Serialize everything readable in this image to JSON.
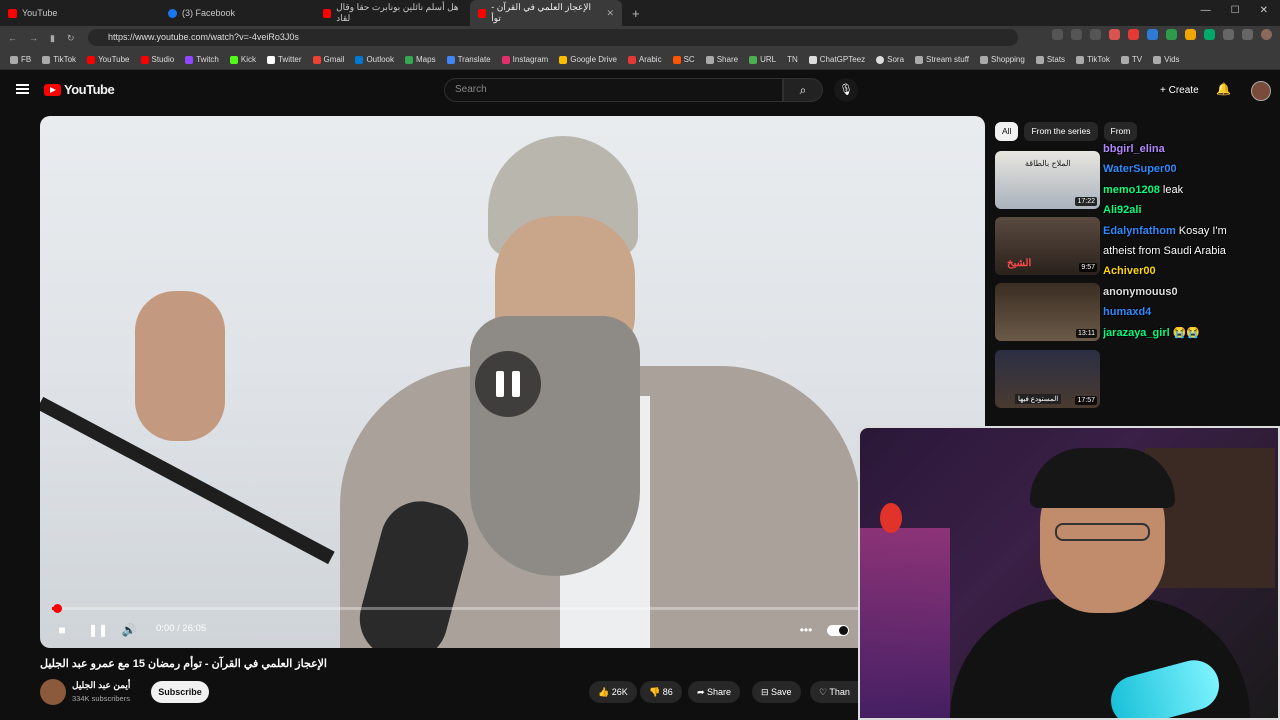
{
  "browser": {
    "tabs": [
      {
        "label": "YouTube",
        "active": false
      },
      {
        "label": "(3) Facebook",
        "active": false
      },
      {
        "label": "هل أسلم نائلين بونابرت حقا وقال لقاد",
        "active": false
      },
      {
        "label": "الإعجاز العلمي في القرآن - توأ",
        "active": true
      }
    ],
    "url": "https://www.youtube.com/watch?v=-4veiRo3J0s",
    "bookmarks": [
      "FB",
      "TikTok",
      "YouTube",
      "Studio",
      "Twitch",
      "Kick",
      "Twitter",
      "Gmail",
      "Outlook",
      "Maps",
      "Translate",
      "Instagram",
      "Google Drive",
      "Arabic",
      "SC",
      "Share",
      "URL",
      "TN",
      "ChatGPTeez",
      "Sora",
      "Stream stuff",
      "Shopping",
      "Stats",
      "TikTok",
      "TV",
      "Vids"
    ]
  },
  "youtube": {
    "logo": "YouTube",
    "search_placeholder": "Search",
    "create_label": "Create"
  },
  "player": {
    "time": "0:00 / 26:05",
    "progress_fraction": 0.005
  },
  "video": {
    "title": "الإعجاز العلمي في القرآن - توأم رمضان 15 مع عمرو عبد الجليل",
    "channel": "أيمن عبد الجليل",
    "subscribers": "334K subscribers",
    "subscribe_label": "Subscribe",
    "likes": "26K",
    "dislikes": "86",
    "share_label": "Share",
    "save_label": "Save",
    "thanks_label": "Than"
  },
  "sidebar": {
    "chips": [
      "All",
      "From the series",
      "From"
    ],
    "recs": [
      {
        "duration": "17:22",
        "thumb_text": "الملاح بالطاقة"
      },
      {
        "duration": "9:57",
        "thumb_text": "الشيخ"
      },
      {
        "duration": "13:11",
        "thumb_text": ""
      },
      {
        "duration": "17:57",
        "thumb_text": "المستودع فيها"
      }
    ]
  },
  "chat": [
    {
      "user": "bbgirl_elina",
      "color": "#b488ff",
      "msg": ""
    },
    {
      "user": "WaterSuper00",
      "color": "#2e8cff",
      "msg": ""
    },
    {
      "user": "memo1208",
      "color": "#00ff7f",
      "msg": "leak"
    },
    {
      "user": "Ali92ali",
      "color": "#00ff7f",
      "msg": ""
    },
    {
      "user": "Edalynfathom",
      "color": "#2e8cff",
      "msg": "Kosay I'm"
    },
    {
      "user": "",
      "color": "#ffffff",
      "msg": "atheist from Saudi Arabia"
    },
    {
      "user": "Achiver00",
      "color": "#ffd700",
      "msg": ""
    },
    {
      "user": "anonymouus0",
      "color": "#dddddd",
      "msg": ""
    },
    {
      "user": "humaxd4",
      "color": "#2e8cff",
      "msg": ""
    },
    {
      "user": "jarazaya_girl",
      "color": "#00ff7f",
      "msg": "😭😭"
    }
  ]
}
